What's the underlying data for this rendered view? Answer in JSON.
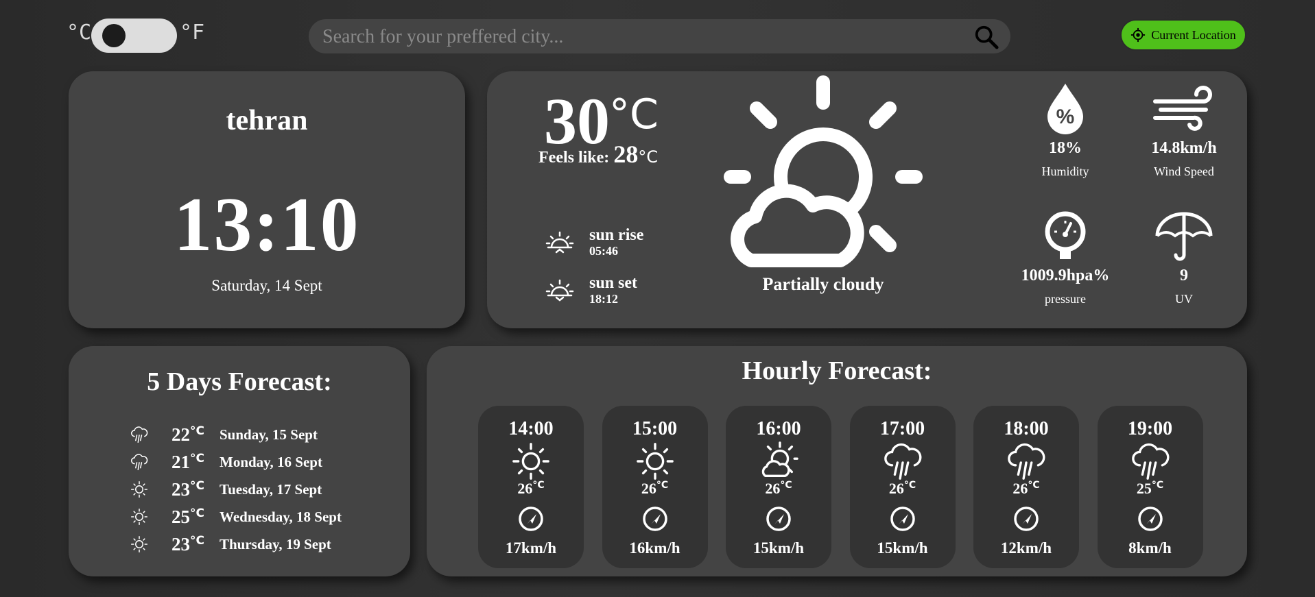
{
  "units": {
    "celsius": "°C",
    "fahrenheit": "°F"
  },
  "search": {
    "placeholder": "Search for your preffered city..."
  },
  "location_button": {
    "label": "Current Location"
  },
  "city": {
    "name": "tehran",
    "time": "13:10",
    "date": "Saturday, 14 Sept"
  },
  "current": {
    "temp": "30",
    "temp_unit": "°C",
    "feels_label": "Feels like:",
    "feels_value": "28",
    "feels_unit": "°C",
    "sunrise_label": "sun rise",
    "sunrise_time": "05:46",
    "sunset_label": "sun set",
    "sunset_time": "18:12",
    "condition": "Partially cloudy",
    "humidity_value": "18%",
    "humidity_label": "Humidity",
    "wind_value": "14.8km/h",
    "wind_label": "Wind Speed",
    "pressure_value": "1009.9hpa%",
    "pressure_label": "pressure",
    "uv_value": "9",
    "uv_label": "UV"
  },
  "five_days": {
    "title": "5 Days Forecast:",
    "items": [
      {
        "icon": "rain-icon",
        "temp": "22",
        "unit": "°C",
        "date": "Sunday, 15 Sept"
      },
      {
        "icon": "rain-icon",
        "temp": "21",
        "unit": "°C",
        "date": "Monday, 16 Sept"
      },
      {
        "icon": "sun-icon",
        "temp": "23",
        "unit": "°C",
        "date": "Tuesday, 17 Sept"
      },
      {
        "icon": "sun-icon",
        "temp": "25",
        "unit": "°C",
        "date": "Wednesday, 18 Sept"
      },
      {
        "icon": "sun-icon",
        "temp": "23",
        "unit": "°C",
        "date": "Thursday, 19 Sept"
      }
    ]
  },
  "hourly": {
    "title": "Hourly Forecast:",
    "items": [
      {
        "time": "14:00",
        "icon": "sun-icon",
        "temp": "26",
        "unit": "°C",
        "speed": "17km/h"
      },
      {
        "time": "15:00",
        "icon": "sun-icon",
        "temp": "26",
        "unit": "°C",
        "speed": "16km/h"
      },
      {
        "time": "16:00",
        "icon": "partly-cloudy-icon",
        "temp": "26",
        "unit": "°C",
        "speed": "15km/h"
      },
      {
        "time": "17:00",
        "icon": "rain-icon",
        "temp": "26",
        "unit": "°C",
        "speed": "15km/h"
      },
      {
        "time": "18:00",
        "icon": "rain-icon",
        "temp": "26",
        "unit": "°C",
        "speed": "12km/h"
      },
      {
        "time": "19:00",
        "icon": "rain-icon",
        "temp": "25",
        "unit": "°C",
        "speed": "8km/h"
      }
    ]
  },
  "colors": {
    "accent": "#4fc01a",
    "card": "#444444",
    "inner_card": "#333333"
  }
}
